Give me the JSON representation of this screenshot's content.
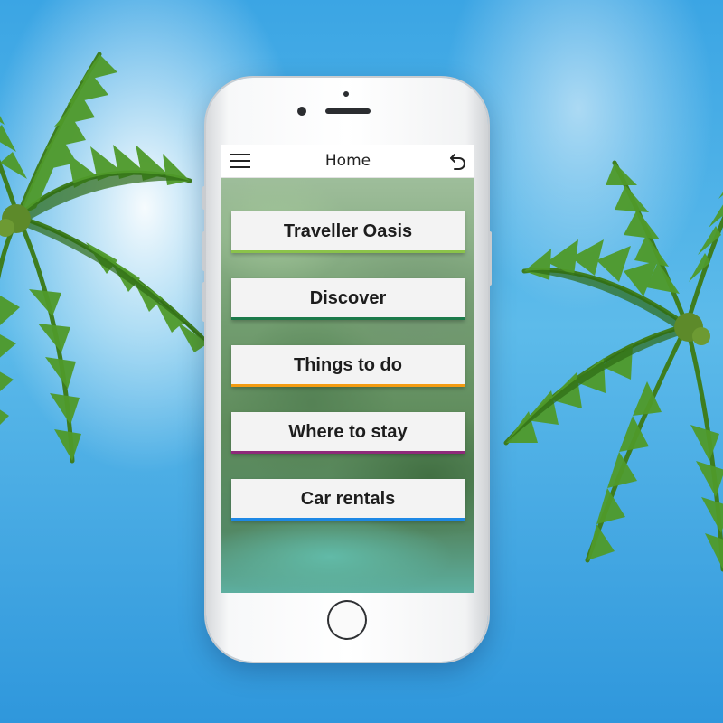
{
  "app": {
    "header": {
      "title": "Home",
      "menu_icon": "hamburger-menu-icon",
      "back_icon": "undo-arrow-icon"
    },
    "menu": [
      {
        "label": "Traveller Oasis",
        "accent": "#8bc34a"
      },
      {
        "label": "Discover",
        "accent": "#1b7a4a"
      },
      {
        "label": "Things to do",
        "accent": "#f39c12"
      },
      {
        "label": "Where to stay",
        "accent": "#8e2a7a"
      },
      {
        "label": "Car rentals",
        "accent": "#1e88e5"
      }
    ]
  },
  "colors": {
    "sky": "#3ba5e4",
    "phone_body": "#f7f8f9",
    "button_bg": "#f3f3f3"
  }
}
